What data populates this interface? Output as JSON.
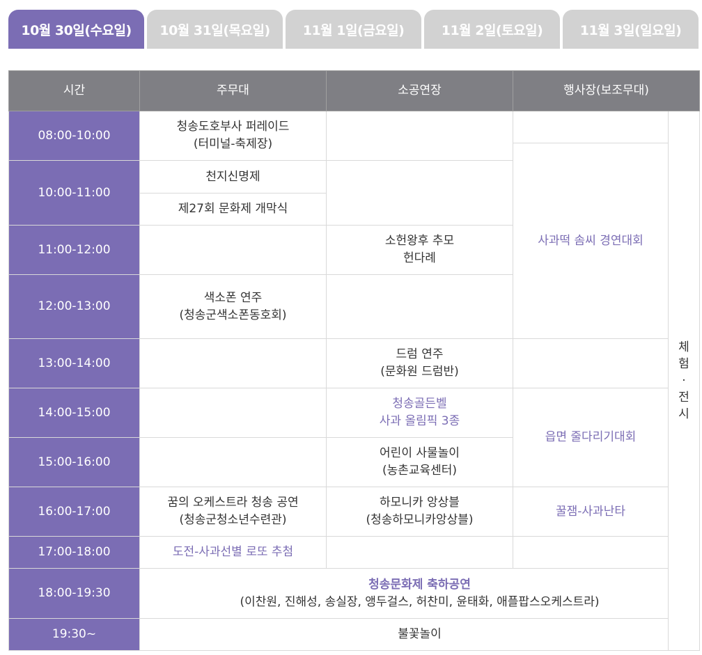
{
  "tabs": [
    {
      "label": "10월 30일(수요일)",
      "active": true
    },
    {
      "label": "10월 31일(목요일)",
      "active": false
    },
    {
      "label": "11월 1일(금요일)",
      "active": false
    },
    {
      "label": "11월 2일(토요일)",
      "active": false
    },
    {
      "label": "11월 3일(일요일)",
      "active": false
    }
  ],
  "colors": {
    "accent": "#7b6db4",
    "header": "#7f7f84",
    "inactive_tab": "#d2d2d2"
  },
  "headers": {
    "time": "시간",
    "main": "주무대",
    "small": "소공연장",
    "venue": "행사장(보조무대)"
  },
  "times": [
    "08:00-10:00",
    "10:00-11:00",
    "11:00-12:00",
    "12:00-13:00",
    "13:00-14:00",
    "14:00-15:00",
    "15:00-16:00",
    "16:00-17:00",
    "17:00-18:00",
    "18:00-19:30",
    "19:30~"
  ],
  "main": {
    "parade_1": "청송도호부사 퍼레이드",
    "parade_2": "(터미널-축제장)",
    "ritual": "천지신명제",
    "opening": "제27회 문화제 개막식",
    "sax_1": "색소폰 연주",
    "sax_2": "(청송군색소폰동호회)",
    "orch_1": "꿈의 오케스트라 청송 공연",
    "orch_2": "(청송군청소년수련관)",
    "lotto": "도전-사과선별 로또 추첨"
  },
  "small": {
    "memorial_1": "소헌왕후 추모",
    "memorial_2": "헌다례",
    "drum_1": "드럼 연주",
    "drum_2": "(문화원 드럼반)",
    "golden_1": "청송골든벨",
    "golden_2": "사과 올림픽 3종",
    "kids_1": "어린이 사물놀이",
    "kids_2": "(농촌교육센터)",
    "harmonica_1": "하모니카 앙상블",
    "harmonica_2": "(청송하모니카앙상블)"
  },
  "venue": {
    "ricecake": "사과떡 솜씨 경연대회",
    "tugofwar": "읍면 줄다리기대회",
    "kkuljaem": "꿀잼-사과난타",
    "exhibit": "체험·전시"
  },
  "span": {
    "celebration_title": "청송문화제 축하공연",
    "celebration_cast": "(이찬원, 진해성, 송실장, 앵두걸스, 허찬미, 윤태화, 애플팝스오케스트라)",
    "fireworks": "불꽃놀이"
  }
}
